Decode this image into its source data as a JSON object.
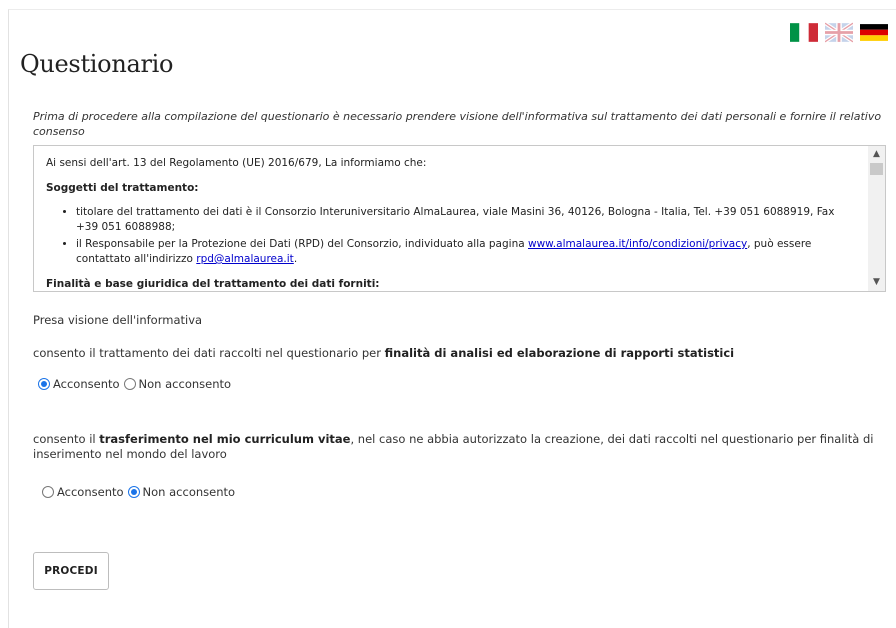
{
  "page": {
    "title": "Questionario",
    "intro": "Prima di procedere alla compilazione del questionario è necessario prendere visione dell'informativa sul trattamento dei dati personali e fornire il relativo consenso"
  },
  "languages": [
    {
      "code": "it",
      "icon": "italy-flag-icon"
    },
    {
      "code": "en",
      "icon": "uk-flag-icon"
    },
    {
      "code": "de",
      "icon": "germany-flag-icon"
    }
  ],
  "informativa": {
    "lead": "Ai sensi dell'art. 13 del Regolamento (UE) 2016/679, La informiamo che:",
    "heading": "Soggetti del trattamento:",
    "bullet1": "titolare del trattamento dei dati è il Consorzio Interuniversitario AlmaLaurea, viale Masini 36, 40126, Bologna - Italia, Tel. +39 051 6088919, Fax +39 051 6088988;",
    "bullet2_pre": "il Responsabile per la Protezione dei Dati (RPD) del Consorzio, individuato alla pagina ",
    "bullet2_link": "www.almalaurea.it/info/condizioni/privacy",
    "bullet2_mid": ", può essere contattato all'indirizzo ",
    "bullet2_email": "rpd@almalaurea.it",
    "bullet2_end": ".",
    "cut_heading": "Finalità e base giuridica del trattamento dei dati forniti:"
  },
  "presa_visione": "Presa visione dell'informativa",
  "consent1": {
    "pre": "consento il trattamento dei dati raccolti nel questionario per ",
    "bold": "finalità di analisi ed elaborazione di rapporti statistici",
    "post": "",
    "options": [
      "Acconsento",
      "Non acconsento"
    ],
    "selected": "Acconsento"
  },
  "consent2": {
    "pre": "consento il ",
    "bold": "trasferimento nel mio curriculum vitae",
    "post": ", nel caso ne abbia autorizzato la creazione, dei dati raccolti nel questionario per finalità di inserimento nel mondo del lavoro",
    "options": [
      "Acconsento",
      "Non acconsento"
    ],
    "selected": "Non acconsento"
  },
  "button": {
    "label": "PROCEDI"
  },
  "colors": {
    "accent": "#1a73e8",
    "link": "#0000cc"
  }
}
